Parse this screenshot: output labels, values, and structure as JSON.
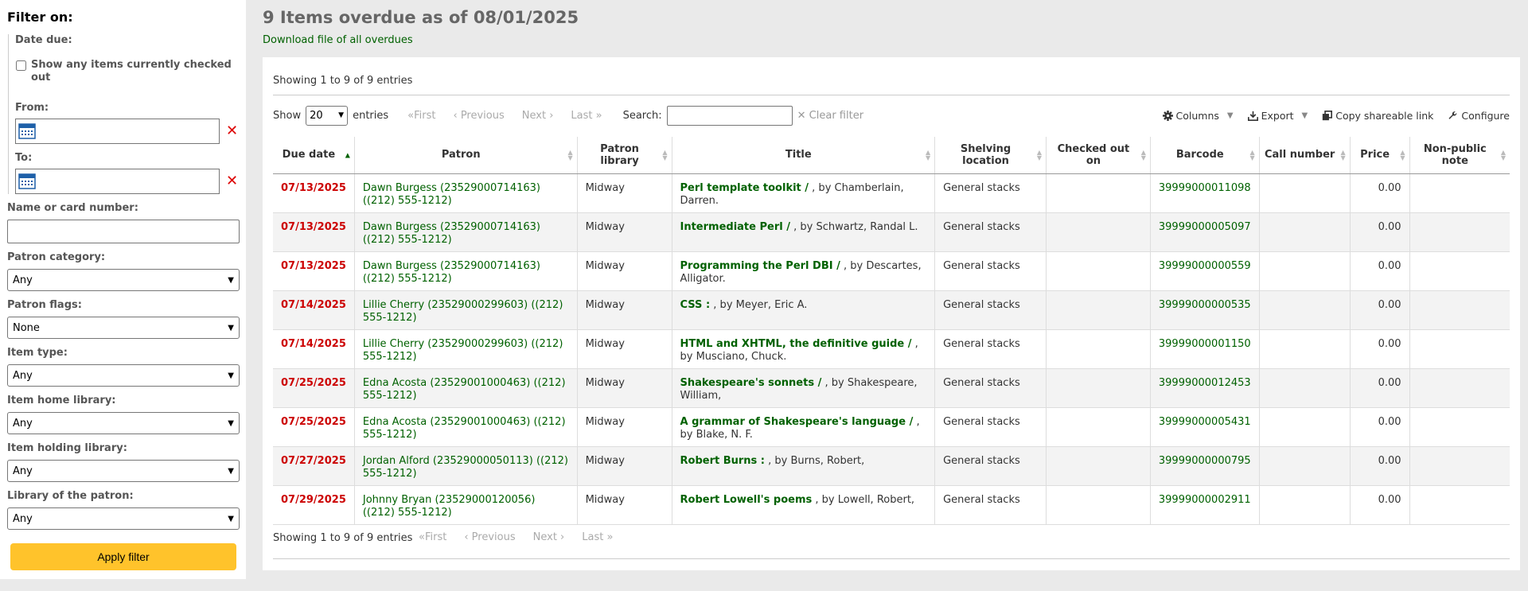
{
  "sidebar": {
    "heading": "Filter on:",
    "date_due_label": "Date due:",
    "checkbox_label": "Show any items currently checked out",
    "from_label": "From:",
    "to_label": "To:",
    "name_label": "Name or card number:",
    "category_label": "Patron category:",
    "category_value": "Any",
    "flags_label": "Patron flags:",
    "flags_value": "None",
    "itemtype_label": "Item type:",
    "itemtype_value": "Any",
    "homelib_label": "Item home library:",
    "homelib_value": "Any",
    "holdlib_label": "Item holding library:",
    "holdlib_value": "Any",
    "patronlib_label": "Library of the patron:",
    "patronlib_value": "Any",
    "apply_label": "Apply filter"
  },
  "main": {
    "title": "9 Items overdue as of 08/01/2025",
    "download_label": "Download file of all overdues",
    "info_text": "Showing 1 to 9 of 9 entries",
    "show_label": "Show",
    "show_value": "20",
    "entries_label": "entries",
    "first_label": "First",
    "previous_label": "Previous",
    "next_label": "Next",
    "last_label": "Last",
    "search_label": "Search:",
    "clear_filter_label": "Clear filter",
    "columns_label": "Columns",
    "export_label": "Export",
    "copy_link_label": "Copy shareable link",
    "configure_label": "Configure"
  },
  "table": {
    "headers": [
      "Due date",
      "Patron",
      "Patron library",
      "Title",
      "Shelving location",
      "Checked out on",
      "Barcode",
      "Call number",
      "Price",
      "Non-public note"
    ],
    "rows": [
      {
        "due": "07/13/2025",
        "patron": "Dawn Burgess (23529000714163)",
        "phone": "((212) 555-1212)",
        "library": "Midway",
        "title": "Perl template toolkit /",
        "author": ", by Chamberlain, Darren.",
        "location": "General stacks",
        "barcode": "39999000011098",
        "price": "0.00"
      },
      {
        "due": "07/13/2025",
        "patron": "Dawn Burgess (23529000714163)",
        "phone": "((212) 555-1212)",
        "library": "Midway",
        "title": "Intermediate Perl /",
        "author": ", by Schwartz, Randal L.",
        "location": "General stacks",
        "barcode": "39999000005097",
        "price": "0.00"
      },
      {
        "due": "07/13/2025",
        "patron": "Dawn Burgess (23529000714163)",
        "phone": "((212) 555-1212)",
        "library": "Midway",
        "title": "Programming the Perl DBI /",
        "author": ", by Descartes, Alligator.",
        "location": "General stacks",
        "barcode": "39999000000559",
        "price": "0.00"
      },
      {
        "due": "07/14/2025",
        "patron": "Lillie Cherry (23529000299603)",
        "phone": "((212) 555-1212)",
        "library": "Midway",
        "title": "CSS :",
        "author": ", by Meyer, Eric A.",
        "location": "General stacks",
        "barcode": "39999000000535",
        "price": "0.00"
      },
      {
        "due": "07/14/2025",
        "patron": "Lillie Cherry (23529000299603)",
        "phone": "((212) 555-1212)",
        "library": "Midway",
        "title": "HTML and XHTML, the definitive guide /",
        "author": ", by Musciano, Chuck.",
        "location": "General stacks",
        "barcode": "39999000001150",
        "price": "0.00"
      },
      {
        "due": "07/25/2025",
        "patron": "Edna Acosta (23529001000463)",
        "phone": "((212) 555-1212)",
        "library": "Midway",
        "title": "Shakespeare's sonnets /",
        "author": ", by Shakespeare, William,",
        "location": "General stacks",
        "barcode": "39999000012453",
        "price": "0.00"
      },
      {
        "due": "07/25/2025",
        "patron": "Edna Acosta (23529001000463)",
        "phone": "((212) 555-1212)",
        "library": "Midway",
        "title": "A grammar of Shakespeare's language /",
        "author": ", by Blake, N. F.",
        "location": "General stacks",
        "barcode": "39999000005431",
        "price": "0.00"
      },
      {
        "due": "07/27/2025",
        "patron": "Jordan Alford (23529000050113)",
        "phone": "((212) 555-1212)",
        "library": "Midway",
        "title": "Robert Burns :",
        "author": ", by Burns, Robert,",
        "location": "General stacks",
        "barcode": "39999000000795",
        "price": "0.00"
      },
      {
        "due": "07/29/2025",
        "patron": "Johnny Bryan (23529000120056)",
        "phone": "((212) 555-1212)",
        "library": "Midway",
        "title": "Robert Lowell's poems",
        "author": ", by Lowell, Robert,",
        "location": "General stacks",
        "barcode": "39999000002911",
        "price": "0.00"
      }
    ]
  },
  "colors": {
    "accent": "#006100",
    "due": "#cc0000",
    "button": "#ffc32b"
  },
  "icons": [
    "calendar-icon",
    "clear-x-icon",
    "gear-icon",
    "download-icon",
    "copy-icon",
    "wrench-icon",
    "sort-icon"
  ]
}
